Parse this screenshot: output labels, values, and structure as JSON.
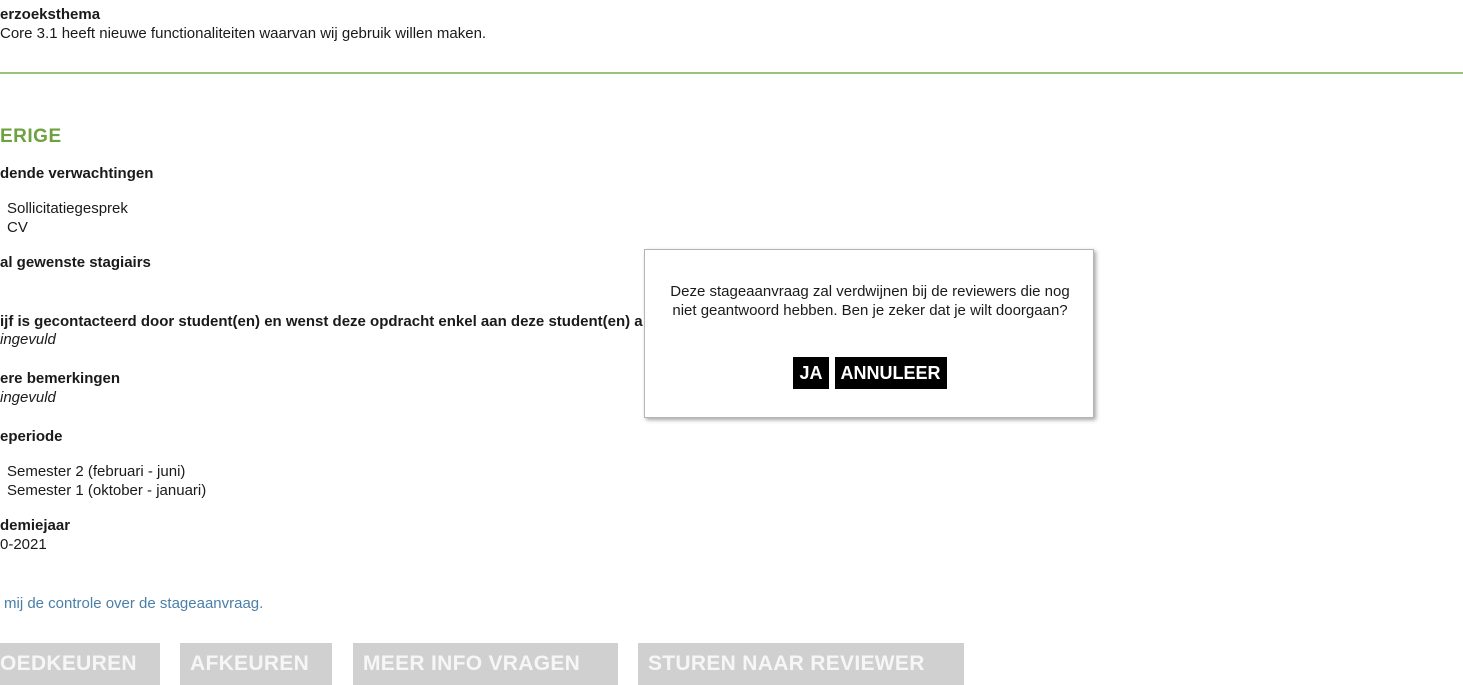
{
  "research_theme": {
    "label": "erzoeksthema",
    "value": "Core 3.1 heeft nieuwe functionaliteiten waarvan wij gebruik willen maken."
  },
  "section_other": {
    "title": "ERIGE",
    "expectations_label": "dende verwachtingen",
    "expectations": [
      "Sollicitatiegesprek",
      "CV"
    ],
    "desired_interns_label": "al gewenste stagiairs",
    "contacted_label": "ijf is gecontacteerd door student(en) en wenst deze opdracht enkel aan deze student(en) a",
    "contacted_value": "ingevuld",
    "remarks_label": "ere bemerkingen",
    "remarks_value": "ingevuld",
    "period_label": "eperiode",
    "periods": [
      "Semester 2 (februari - juni)",
      "Semester 1 (oktober - januari)"
    ],
    "academic_year_label": "demiejaar",
    "academic_year_value": "0-2021"
  },
  "control_link": "mij de controle over de stageaanvraag.",
  "actions": {
    "approve": "OEDKEUREN",
    "reject": "AFKEUREN",
    "more_info": "MEER INFO VRAGEN",
    "send_reviewer": "STUREN NAAR REVIEWER"
  },
  "dialog": {
    "message": "Deze stageaanvraag zal verdwijnen bij de reviewers die nog niet geantwoord hebben. Ben je zeker dat je wilt doorgaan?",
    "yes_label": "JA",
    "cancel_label": "ANNULEER"
  }
}
